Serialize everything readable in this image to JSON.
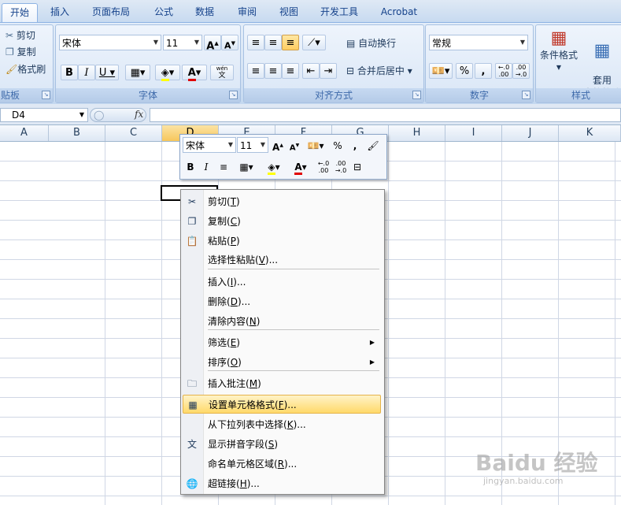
{
  "tabs": [
    "开始",
    "插入",
    "页面布局",
    "公式",
    "数据",
    "审阅",
    "视图",
    "开发工具",
    "Acrobat"
  ],
  "clipboard": {
    "cut": "剪切",
    "copy": "复制",
    "format_painter": "格式刷",
    "title": "贴板"
  },
  "font": {
    "name": "宋体",
    "size": "11",
    "title": "字体",
    "phonetic": "wén"
  },
  "align": {
    "wrap": "自动换行",
    "merge": "合并后居中",
    "title": "对齐方式"
  },
  "number": {
    "format": "常规",
    "title": "数字",
    "percent": "%",
    "comma": ","
  },
  "styles": {
    "cond_format": "条件格式",
    "table_format": "套用\n表格格式",
    "title": "样式"
  },
  "formula_bar": {
    "name_box": "D4",
    "fx": "fx"
  },
  "columns": [
    "A",
    "B",
    "C",
    "D",
    "E",
    "F",
    "G",
    "H",
    "I",
    "J",
    "K"
  ],
  "selected_column": "D",
  "mini_toolbar": {
    "font": "宋体",
    "size": "11"
  },
  "context_menu": [
    {
      "label": "剪切",
      "key": "T",
      "icon": "scissors-icon",
      "glyph": "✂"
    },
    {
      "label": "复制",
      "key": "C",
      "icon": "copy-icon",
      "glyph": "❐"
    },
    {
      "label": "粘贴",
      "key": "P",
      "icon": "paste-icon",
      "glyph": "📋"
    },
    {
      "label": "选择性粘贴",
      "key": "V",
      "suffix": "...",
      "icon": "",
      "glyph": ""
    },
    {
      "label": "插入",
      "key": "I",
      "suffix": "...",
      "icon": "",
      "glyph": ""
    },
    {
      "label": "删除",
      "key": "D",
      "suffix": "...",
      "icon": "",
      "glyph": ""
    },
    {
      "label": "清除内容",
      "key": "N",
      "icon": "",
      "glyph": ""
    },
    {
      "label": "筛选",
      "key": "E",
      "icon": "",
      "glyph": "",
      "submenu": true
    },
    {
      "label": "排序",
      "key": "O",
      "icon": "",
      "glyph": "",
      "submenu": true
    },
    {
      "label": "插入批注",
      "key": "M",
      "icon": "comment-icon",
      "glyph": "🗀"
    },
    {
      "label": "设置单元格格式",
      "key": "F",
      "suffix": "...",
      "icon": "format-cells-icon",
      "glyph": "▦",
      "highlight": true
    },
    {
      "label": "从下拉列表中选择",
      "key": "K",
      "suffix": "...",
      "icon": "",
      "glyph": ""
    },
    {
      "label": "显示拼音字段",
      "key": "S",
      "icon": "phonetic-icon",
      "glyph": "文"
    },
    {
      "label": "命名单元格区域",
      "key": "R",
      "suffix": "...",
      "icon": "",
      "glyph": ""
    },
    {
      "label": "超链接",
      "key": "H",
      "suffix": "...",
      "icon": "hyperlink-icon",
      "glyph": "🌐"
    }
  ],
  "watermark": {
    "text": "Baidu 经验",
    "sub": "jingyan.baidu.com"
  },
  "colors": {
    "accent": "#15428b",
    "highlight": "#ffd96a",
    "ribbon": "#d5e3f4"
  }
}
